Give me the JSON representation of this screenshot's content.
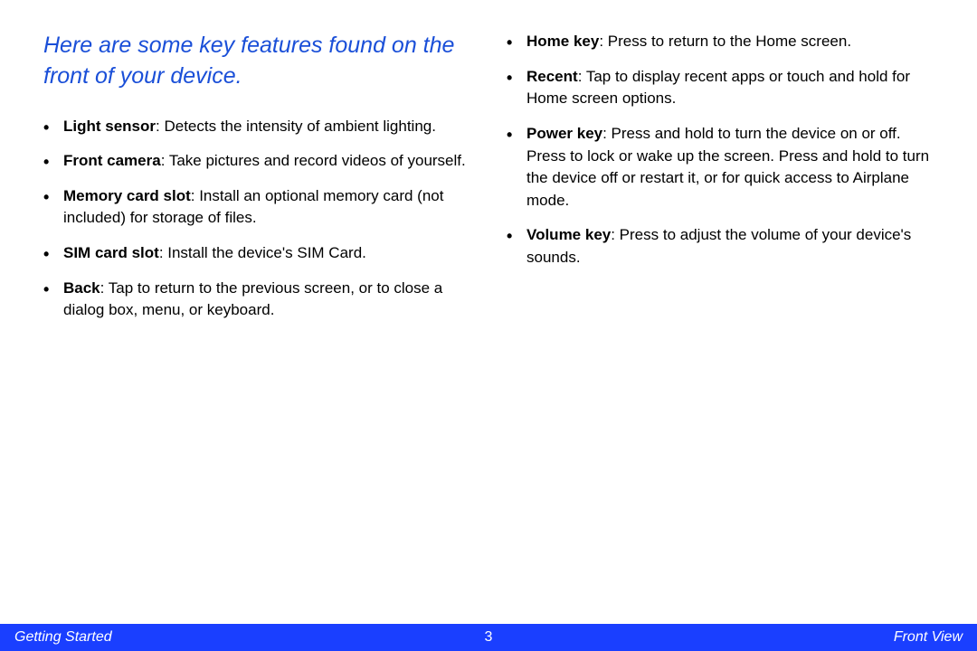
{
  "intro": "Here are some key features found on the front of your device.",
  "left_items": [
    {
      "term": "Light sensor",
      "desc": ": Detects the intensity of ambient lighting."
    },
    {
      "term": "Front camera",
      "desc": ": Take pictures and record videos of yourself."
    },
    {
      "term": "Memory card slot",
      "desc": ": Install an optional memory card (not included) for storage of files."
    },
    {
      "term": "SIM card slot",
      "desc": ": Install the device's SIM Card."
    },
    {
      "term": "Back",
      "desc": ": Tap to return to the previous screen, or to close a dialog box, menu, or keyboard."
    }
  ],
  "right_items": [
    {
      "term": "Home key",
      "desc": ": Press to return to the Home screen."
    },
    {
      "term": "Recent",
      "desc": ": Tap to display recent apps or touch and hold for Home screen options."
    },
    {
      "term": "Power key",
      "desc": ": Press and hold to turn the device on or off. Press to lock or wake up the screen. Press and hold to turn the device off or restart it, or for quick access to Airplane mode."
    },
    {
      "term": "Volume key",
      "desc": ": Press to adjust the volume of your device's sounds."
    }
  ],
  "footer": {
    "left": "Getting Started",
    "center": "3",
    "right": "Front View"
  }
}
